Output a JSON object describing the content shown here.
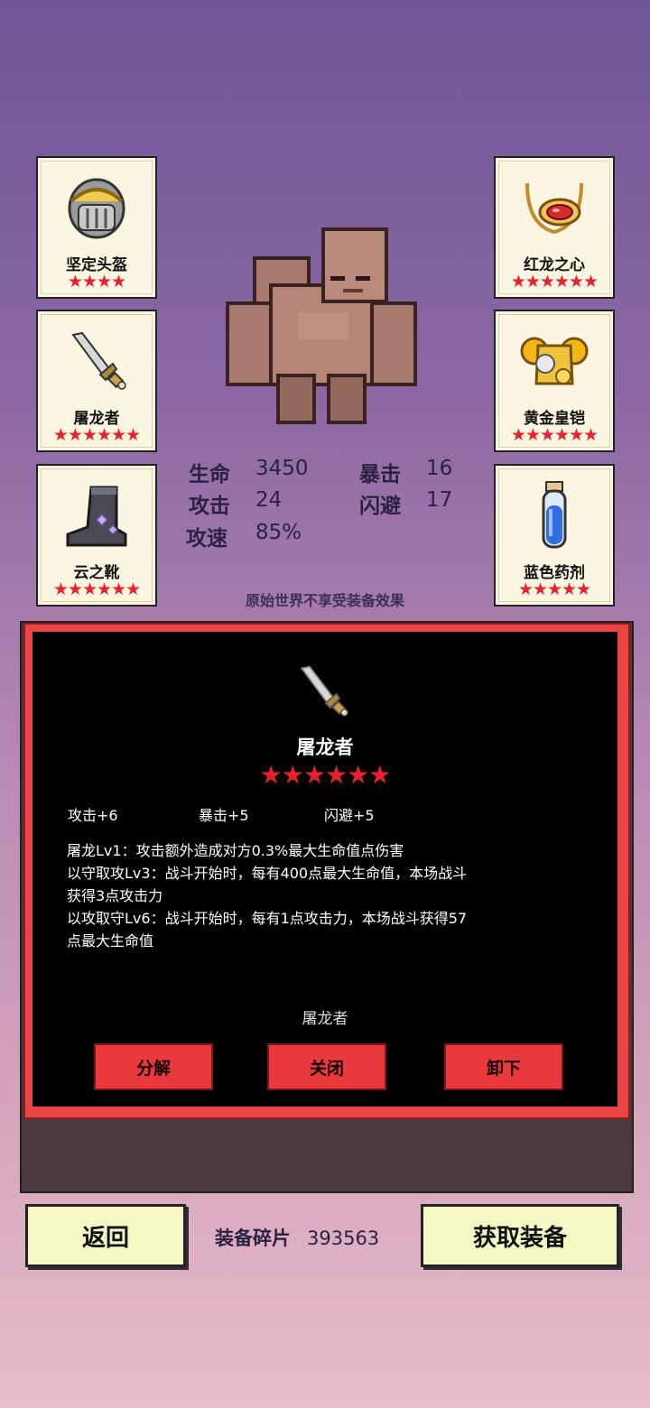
{
  "equipment_slots": [
    {
      "name": "坚定头盔",
      "stars": "★★★★",
      "icon": "helmet-icon"
    },
    {
      "name": "屠龙者",
      "stars": "★★★★★★",
      "icon": "dagger-icon"
    },
    {
      "name": "云之靴",
      "stars": "★★★★★★",
      "icon": "boots-icon"
    },
    {
      "name": "红龙之心",
      "stars": "★★★★★★",
      "icon": "amulet-icon"
    },
    {
      "name": "黄金皇铠",
      "stars": "★★★★★★",
      "icon": "armor-icon"
    },
    {
      "name": "蓝色药剂",
      "stars": "★★★★★",
      "icon": "potion-icon"
    }
  ],
  "stats": {
    "hp_label": "生命",
    "hp_value": "3450",
    "crit_label": "暴击",
    "crit_value": "16",
    "atk_label": "攻击",
    "atk_value": "24",
    "dodge_label": "闪避",
    "dodge_value": "17",
    "speed_label": "攻速",
    "speed_value": "85%"
  },
  "note": "原始世界不享受装备效果",
  "detail": {
    "title": "屠龙者",
    "stars": "★★★★★★",
    "bonuses": [
      "攻击+6",
      "暴击+5",
      "闪避+5"
    ],
    "lines": [
      "屠龙Lv1：攻击额外造成对方0.3%最大生命值点伤害",
      "以守取攻Lv3：战斗开始时，每有400点最大生命值，本场战斗",
      "获得3点攻击力",
      "以攻取守Lv6：战斗开始时，每有1点攻击力，本场战斗获得57",
      "点最大生命值"
    ],
    "owner": "屠龙者",
    "buttons": {
      "decompose": "分解",
      "close": "关闭",
      "unequip": "卸下"
    }
  },
  "footer": {
    "back": "返回",
    "fragments_label": "装备碎片",
    "fragments_value": "393563",
    "get_equipment": "获取装备"
  },
  "colors": {
    "star": "#e8212a",
    "panel_border": "#ea4444",
    "button_bg": "#f4f7c4"
  }
}
